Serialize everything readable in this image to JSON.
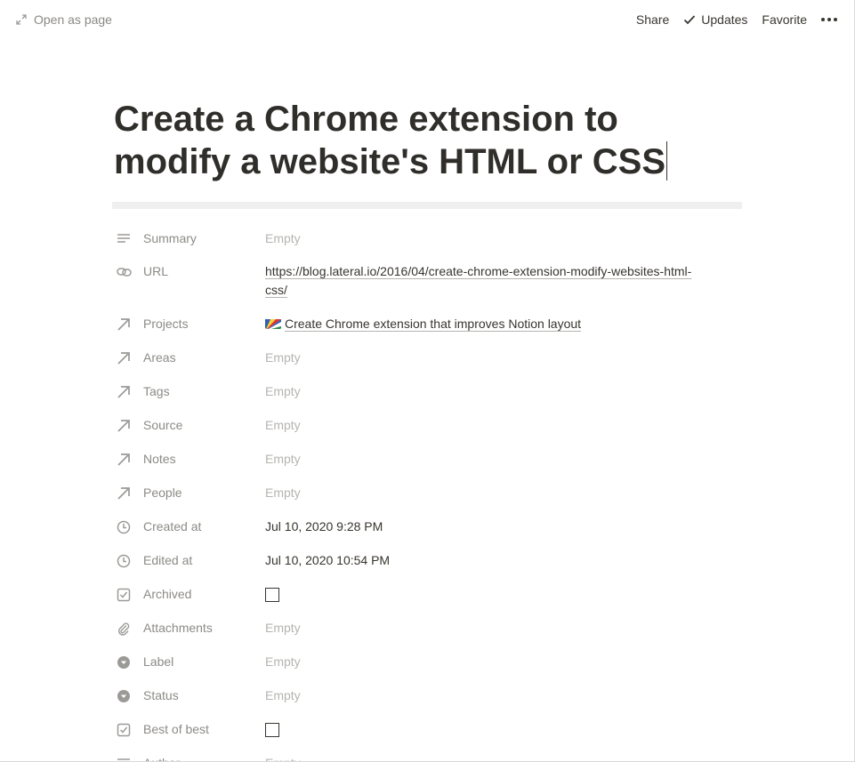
{
  "topbar": {
    "open_as_page": "Open as page",
    "share": "Share",
    "updates": "Updates",
    "favorite": "Favorite"
  },
  "title": "Create a Chrome extension to modify a website's HTML or CSS",
  "properties": [
    {
      "name": "Summary",
      "icon": "text-lines-icon",
      "value": "Empty",
      "empty": true
    },
    {
      "name": "URL",
      "icon": "link-icon",
      "value": "https://blog.lateral.io/2016/04/create-chrome-extension-modify-websites-html-css/",
      "value_line1": "https://blog.lateral.io/2016/04/create-chrome-extension-modify-websites-html-",
      "value_line2": "css/"
    },
    {
      "name": "Projects",
      "icon": "relation-arrow-icon",
      "value": "Create Chrome extension that improves Notion layout"
    },
    {
      "name": "Areas",
      "icon": "relation-arrow-icon",
      "value": "Empty",
      "empty": true
    },
    {
      "name": "Tags",
      "icon": "relation-arrow-icon",
      "value": "Empty",
      "empty": true
    },
    {
      "name": "Source",
      "icon": "relation-arrow-icon",
      "value": "Empty",
      "empty": true
    },
    {
      "name": "Notes",
      "icon": "relation-arrow-icon",
      "value": "Empty",
      "empty": true
    },
    {
      "name": "People",
      "icon": "relation-arrow-icon",
      "value": "Empty",
      "empty": true
    },
    {
      "name": "Created at",
      "icon": "clock-icon",
      "value": "Jul 10, 2020 9:28 PM"
    },
    {
      "name": "Edited at",
      "icon": "clock-icon",
      "value": "Jul 10, 2020 10:54 PM"
    },
    {
      "name": "Archived",
      "icon": "checkbox-icon",
      "value": "",
      "checked": false
    },
    {
      "name": "Attachments",
      "icon": "paperclip-icon",
      "value": "Empty",
      "empty": true
    },
    {
      "name": "Label",
      "icon": "select-icon",
      "value": "Empty",
      "empty": true
    },
    {
      "name": "Status",
      "icon": "select-icon",
      "value": "Empty",
      "empty": true
    },
    {
      "name": "Best of best",
      "icon": "checkbox-icon",
      "value": "",
      "checked": false
    },
    {
      "name": "Author",
      "icon": "text-lines-icon",
      "value": "Empty",
      "empty": true
    }
  ]
}
